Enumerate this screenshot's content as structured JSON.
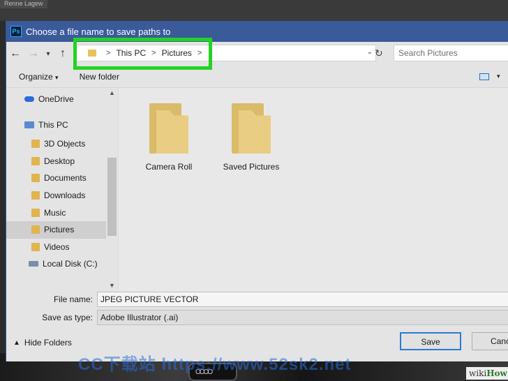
{
  "background": {
    "tab_label": "Renne Lagew"
  },
  "dialog": {
    "title": "Choose a file name to save paths to",
    "app_icon_text": "Ps"
  },
  "navigation": {
    "back_icon": "←",
    "forward_icon": "→",
    "recent_icon": "▾",
    "up_icon": "↑",
    "breadcrumbs": [
      "This PC",
      "Pictures"
    ],
    "separator": ">",
    "refresh_icon": "↻",
    "dropdown_icon": "⌄",
    "search_placeholder": "Search Pictures"
  },
  "toolbar": {
    "organize_label": "Organize",
    "organize_arrow": "▾",
    "new_folder_label": "New folder",
    "view_arrow": "▾"
  },
  "sidebar": {
    "items": [
      {
        "label": "OneDrive",
        "icon": "onedrive-icon",
        "color": "#2b6cd4"
      },
      {
        "label": "This PC",
        "icon": "computer-icon",
        "color": "#5a8ad0"
      },
      {
        "label": "3D Objects",
        "icon": "3d-objects-folder-icon",
        "color": "#e0b44e"
      },
      {
        "label": "Desktop",
        "icon": "desktop-folder-icon",
        "color": "#e0b44e"
      },
      {
        "label": "Documents",
        "icon": "documents-folder-icon",
        "color": "#e0b44e"
      },
      {
        "label": "Downloads",
        "icon": "downloads-folder-icon",
        "color": "#e0b44e"
      },
      {
        "label": "Music",
        "icon": "music-folder-icon",
        "color": "#e0b44e"
      },
      {
        "label": "Pictures",
        "icon": "pictures-folder-icon",
        "color": "#e0b44e"
      },
      {
        "label": "Videos",
        "icon": "videos-folder-icon",
        "color": "#e0b44e"
      },
      {
        "label": "Local Disk (C:)",
        "icon": "disk-icon",
        "color": "#7a8ea8"
      }
    ],
    "selected": "Pictures",
    "scroll_up": "▲",
    "scroll_down": "▼"
  },
  "files": [
    {
      "name": "Camera Roll",
      "icon": "folder-icon"
    },
    {
      "name": "Saved Pictures",
      "icon": "folder-icon"
    }
  ],
  "form": {
    "file_name_label": "File name:",
    "file_name_value": "JPEG PICTURE VECTOR",
    "save_type_label": "Save as type:",
    "save_type_value": "Adobe Illustrator (.ai)"
  },
  "footer": {
    "hide_folders_label": "Hide Folders",
    "hide_chevron": "▲",
    "save_label": "Save",
    "cancel_label": "Canc"
  },
  "overlay": {
    "watermark": "CC下载站 https://www.52sk2.net",
    "wikihow_wiki": "wiki",
    "wikihow_how": "How"
  },
  "colors": {
    "titlebar": "#3a5a9a",
    "highlight_box": "#22d422",
    "selected_item": "#cfcfcf",
    "primary_button_border": "#2b79d6"
  }
}
